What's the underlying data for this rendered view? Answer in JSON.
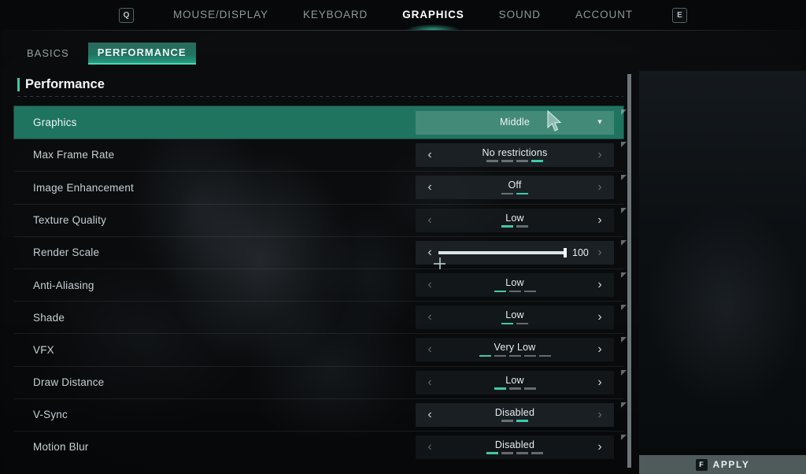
{
  "nav": {
    "left_key": "Q",
    "right_key": "E",
    "tabs": [
      {
        "label": "MOUSE/DISPLAY",
        "active": false
      },
      {
        "label": "KEYBOARD",
        "active": false
      },
      {
        "label": "GRAPHICS",
        "active": true
      },
      {
        "label": "SOUND",
        "active": false
      },
      {
        "label": "ACCOUNT",
        "active": false
      }
    ]
  },
  "subtabs": [
    {
      "label": "BASICS",
      "active": false
    },
    {
      "label": "PERFORMANCE",
      "active": true
    }
  ],
  "section": {
    "title": "Performance"
  },
  "settings": [
    {
      "label": "Graphics",
      "type": "dropdown",
      "value": "Middle",
      "highlighted": true,
      "chevron": "▾"
    },
    {
      "label": "Max Frame Rate",
      "type": "stepper",
      "value": "No restrictions",
      "segments": 4,
      "active_segment": 4,
      "dim": false
    },
    {
      "label": "Image Enhancement",
      "type": "stepper",
      "value": "Off",
      "segments": 2,
      "active_segment": 2,
      "dim": false
    },
    {
      "label": "Texture Quality",
      "type": "stepper",
      "value": "Low",
      "segments": 2,
      "active_segment": 1,
      "dim": true
    },
    {
      "label": "Render Scale",
      "type": "slider",
      "value": "100",
      "fill_percent": 100,
      "dim": false
    },
    {
      "label": "Anti-Aliasing",
      "type": "stepper",
      "value": "Low",
      "segments": 3,
      "active_segment": 1,
      "dim": true
    },
    {
      "label": "Shade",
      "type": "stepper",
      "value": "Low",
      "segments": 2,
      "active_segment": 1,
      "dim": true
    },
    {
      "label": "VFX",
      "type": "stepper",
      "value": "Very Low",
      "segments": 5,
      "active_segment": 1,
      "dim": true
    },
    {
      "label": "Draw Distance",
      "type": "stepper",
      "value": "Low",
      "segments": 3,
      "active_segment": 1,
      "dim": true
    },
    {
      "label": "V-Sync",
      "type": "stepper",
      "value": "Disabled",
      "segments": 2,
      "active_segment": 2,
      "dim": false
    },
    {
      "label": "Motion Blur",
      "type": "stepper",
      "value": "Disabled",
      "segments": 4,
      "active_segment": 1,
      "dim": true
    }
  ],
  "apply": {
    "key": "F",
    "label": "APPLY"
  },
  "icons": {
    "left_arrow": "‹",
    "right_arrow": "›"
  },
  "colors": {
    "accent_teal": "#1f7460",
    "accent_bright": "#3fc9a8",
    "panel_bg": "#1e2529",
    "text_primary": "#e6eef0",
    "text_secondary": "#97a2a5"
  }
}
